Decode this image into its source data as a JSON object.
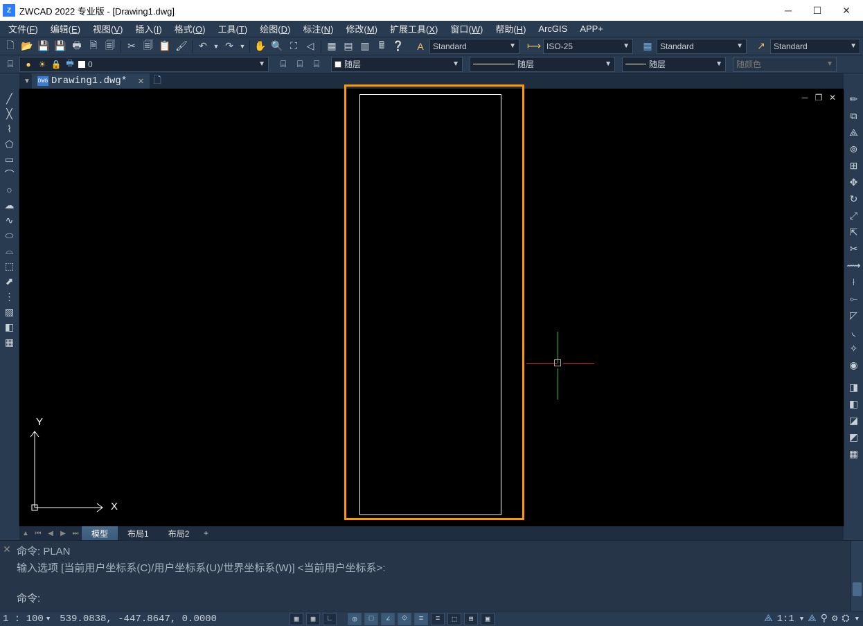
{
  "title_bar": {
    "app_name": "ZWCAD 2022 专业版 - [Drawing1.dwg]"
  },
  "menu": {
    "items": [
      {
        "label": "文件",
        "key": "F"
      },
      {
        "label": "编辑",
        "key": "E"
      },
      {
        "label": "视图",
        "key": "V"
      },
      {
        "label": "插入",
        "key": "I"
      },
      {
        "label": "格式",
        "key": "O"
      },
      {
        "label": "工具",
        "key": "T"
      },
      {
        "label": "绘图",
        "key": "D"
      },
      {
        "label": "标注",
        "key": "N"
      },
      {
        "label": "修改",
        "key": "M"
      },
      {
        "label": "扩展工具",
        "key": "X"
      },
      {
        "label": "窗口",
        "key": "W"
      },
      {
        "label": "帮助",
        "key": "H"
      }
    ],
    "extra": [
      "ArcGIS",
      "APP+"
    ]
  },
  "toolbar1": {
    "text_style": "Standard",
    "dim_style": "ISO-25",
    "table_style": "Standard",
    "mleader_style": "Standard"
  },
  "toolbar2": {
    "layer_value": "0",
    "color_label": "随层",
    "linetype_label": "随层",
    "lineweight_label": "随层",
    "plot_style": "随颜色"
  },
  "doc_tabs": {
    "active": "Drawing1.dwg*"
  },
  "layout_tabs": {
    "model": "模型",
    "layout1": "布局1",
    "layout2": "布局2"
  },
  "command": {
    "line1": "命令: PLAN",
    "line2": "输入选项 [当前用户坐标系(C)/用户坐标系(U)/世界坐标系(W)] <当前用户坐标系>:",
    "prompt": "命令:"
  },
  "status": {
    "scale": "1 : 100",
    "coords": "539.0838, -447.8647, 0.0000",
    "anno_scale": "1:1"
  },
  "ucs": {
    "x": "X",
    "y": "Y"
  }
}
